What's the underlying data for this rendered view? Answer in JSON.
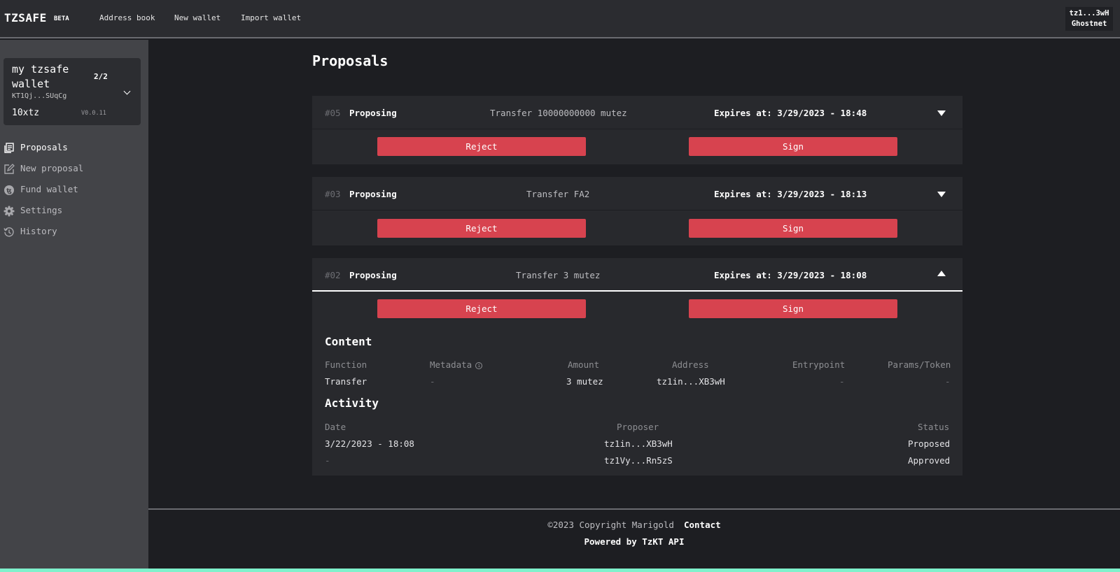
{
  "header": {
    "brand": "TZSAFE",
    "beta": "BETA",
    "nav": [
      "Address book",
      "New wallet",
      "Import wallet"
    ],
    "account": {
      "address": "tz1...3wH",
      "network": "Ghostnet"
    }
  },
  "sidebar": {
    "wallet": {
      "name": "my tzsafe wallet",
      "threshold": "2/2",
      "address": "KT1Qj...SUqCg",
      "balance": "10xtz",
      "version": "V0.0.11"
    },
    "items": [
      {
        "label": "Proposals",
        "icon": "proposals-icon",
        "active": true
      },
      {
        "label": "New proposal",
        "icon": "edit-icon"
      },
      {
        "label": "Fund wallet",
        "icon": "tezos-coin-icon"
      },
      {
        "label": "Settings",
        "icon": "gear-icon"
      },
      {
        "label": "History",
        "icon": "history-icon"
      }
    ]
  },
  "main": {
    "title": "Proposals",
    "proposals": [
      {
        "id": "#05",
        "state": "Proposing",
        "description": "Transfer 10000000000 mutez",
        "expires": "Expires at: 3/29/2023 - 18:48",
        "reject_label": "Reject",
        "sign_label": "Sign",
        "expanded": false
      },
      {
        "id": "#03",
        "state": "Proposing",
        "description": "Transfer FA2",
        "expires": "Expires at: 3/29/2023 - 18:13",
        "reject_label": "Reject",
        "sign_label": "Sign",
        "expanded": false
      },
      {
        "id": "#02",
        "state": "Proposing",
        "description": "Transfer 3 mutez",
        "expires": "Expires at: 3/29/2023 - 18:08",
        "reject_label": "Reject",
        "sign_label": "Sign",
        "expanded": true,
        "content": {
          "title": "Content",
          "columns": [
            "Function",
            "Metadata",
            "Amount",
            "Address",
            "Entrypoint",
            "Params/Token"
          ],
          "metadata_info_icon": "ⓘ",
          "row": [
            "Transfer",
            "-",
            "3 mutez",
            "tz1in...XB3wH",
            "-",
            "-"
          ]
        },
        "activity": {
          "title": "Activity",
          "columns": [
            "Date",
            "Proposer",
            "Status"
          ],
          "rows": [
            [
              "3/22/2023 - 18:08",
              "tz1in...XB3wH",
              "Proposed"
            ],
            [
              "-",
              "tz1Vy...Rn5zS",
              "Approved"
            ]
          ]
        }
      }
    ]
  },
  "footer": {
    "copyright": "©2023 Copyright Marigold",
    "contact": "Contact",
    "powered": "Powered by TzKT API"
  },
  "colors": {
    "background": "#1d1e22",
    "topbar": "#2b2c30",
    "sidebar": "#434448",
    "card": "#28292d",
    "button": "#d7434f",
    "accent": "#7ff1cc"
  }
}
